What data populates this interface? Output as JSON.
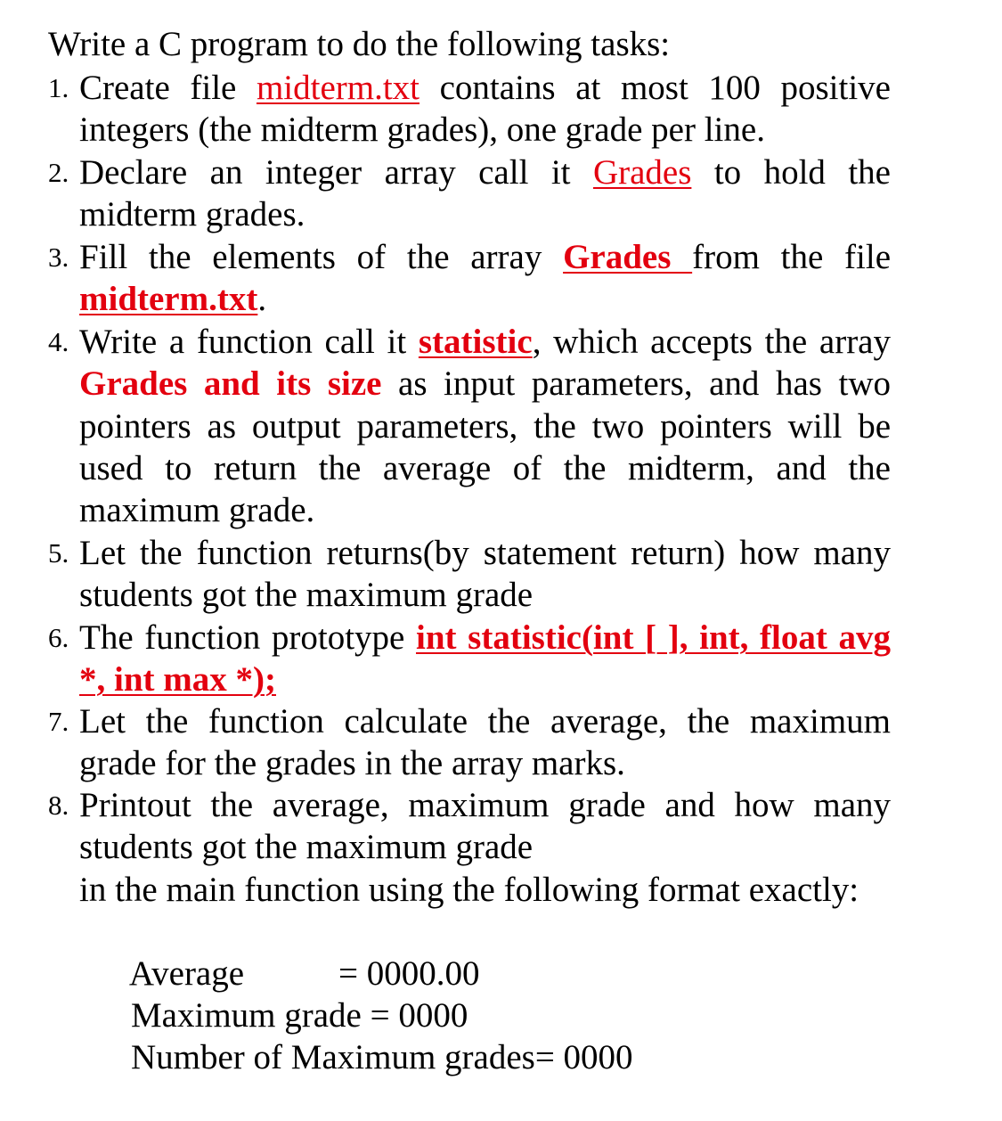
{
  "title": "Write a C program to do the following tasks:",
  "tasks": [
    {
      "number": "1.",
      "line1": {
        "pre": "Create file ",
        "link": "midterm.txt",
        "post": " contains at most 100 positive"
      },
      "line2": "integers (the midterm grades), one grade per line."
    },
    {
      "number": "2.",
      "line1": {
        "pre": "Declare an integer array call it ",
        "link": "Grades",
        "post": " to hold the"
      },
      "line2": "midterm grades."
    },
    {
      "number": "3.",
      "line1": {
        "pre": "Fill the elements of the array ",
        "link": "Grades ",
        "post": "from the file"
      },
      "line2": {
        "link": "midterm.txt",
        "post": "."
      }
    },
    {
      "number": "4.",
      "line1": {
        "pre": "Write a function call it ",
        "link": "statistic",
        "post": ", which accepts the array"
      },
      "line2": {
        "highlight": "Grades and its size",
        "post": " as input parameters, and has two"
      },
      "line3": "pointers as output parameters, the two pointers will be",
      "line4": "used to return the average of the midterm, and the",
      "line5": "maximum grade."
    },
    {
      "number": "5.",
      "line1": "Let the function returns(by statement return) how many",
      "line2": "students got the maximum grade"
    },
    {
      "number": "6.",
      "line1": {
        "pre": "The function prototype ",
        "code": "int statistic(int [ ], int, float avg"
      },
      "line2": {
        "code": "*, int max *);"
      }
    },
    {
      "number": "7.",
      "line1": "Let the function calculate the average, the maximum",
      "line2": "grade for the grades in the array marks."
    },
    {
      "number": "8.",
      "line1": "Printout the average, maximum grade and how many",
      "line2": "students got the maximum grade",
      "line3": "in the main function using the following format exactly:"
    }
  ],
  "output_format": [
    {
      "label": "Average",
      "value": "= 0000.00"
    },
    {
      "label": "Maximum grade",
      "value": "= 0000"
    },
    {
      "label": "Number of Maximum grades= 0000",
      "value": ""
    }
  ],
  "colors": {
    "accent": "#e3000f",
    "text": "#000000",
    "background": "#ffffff"
  }
}
